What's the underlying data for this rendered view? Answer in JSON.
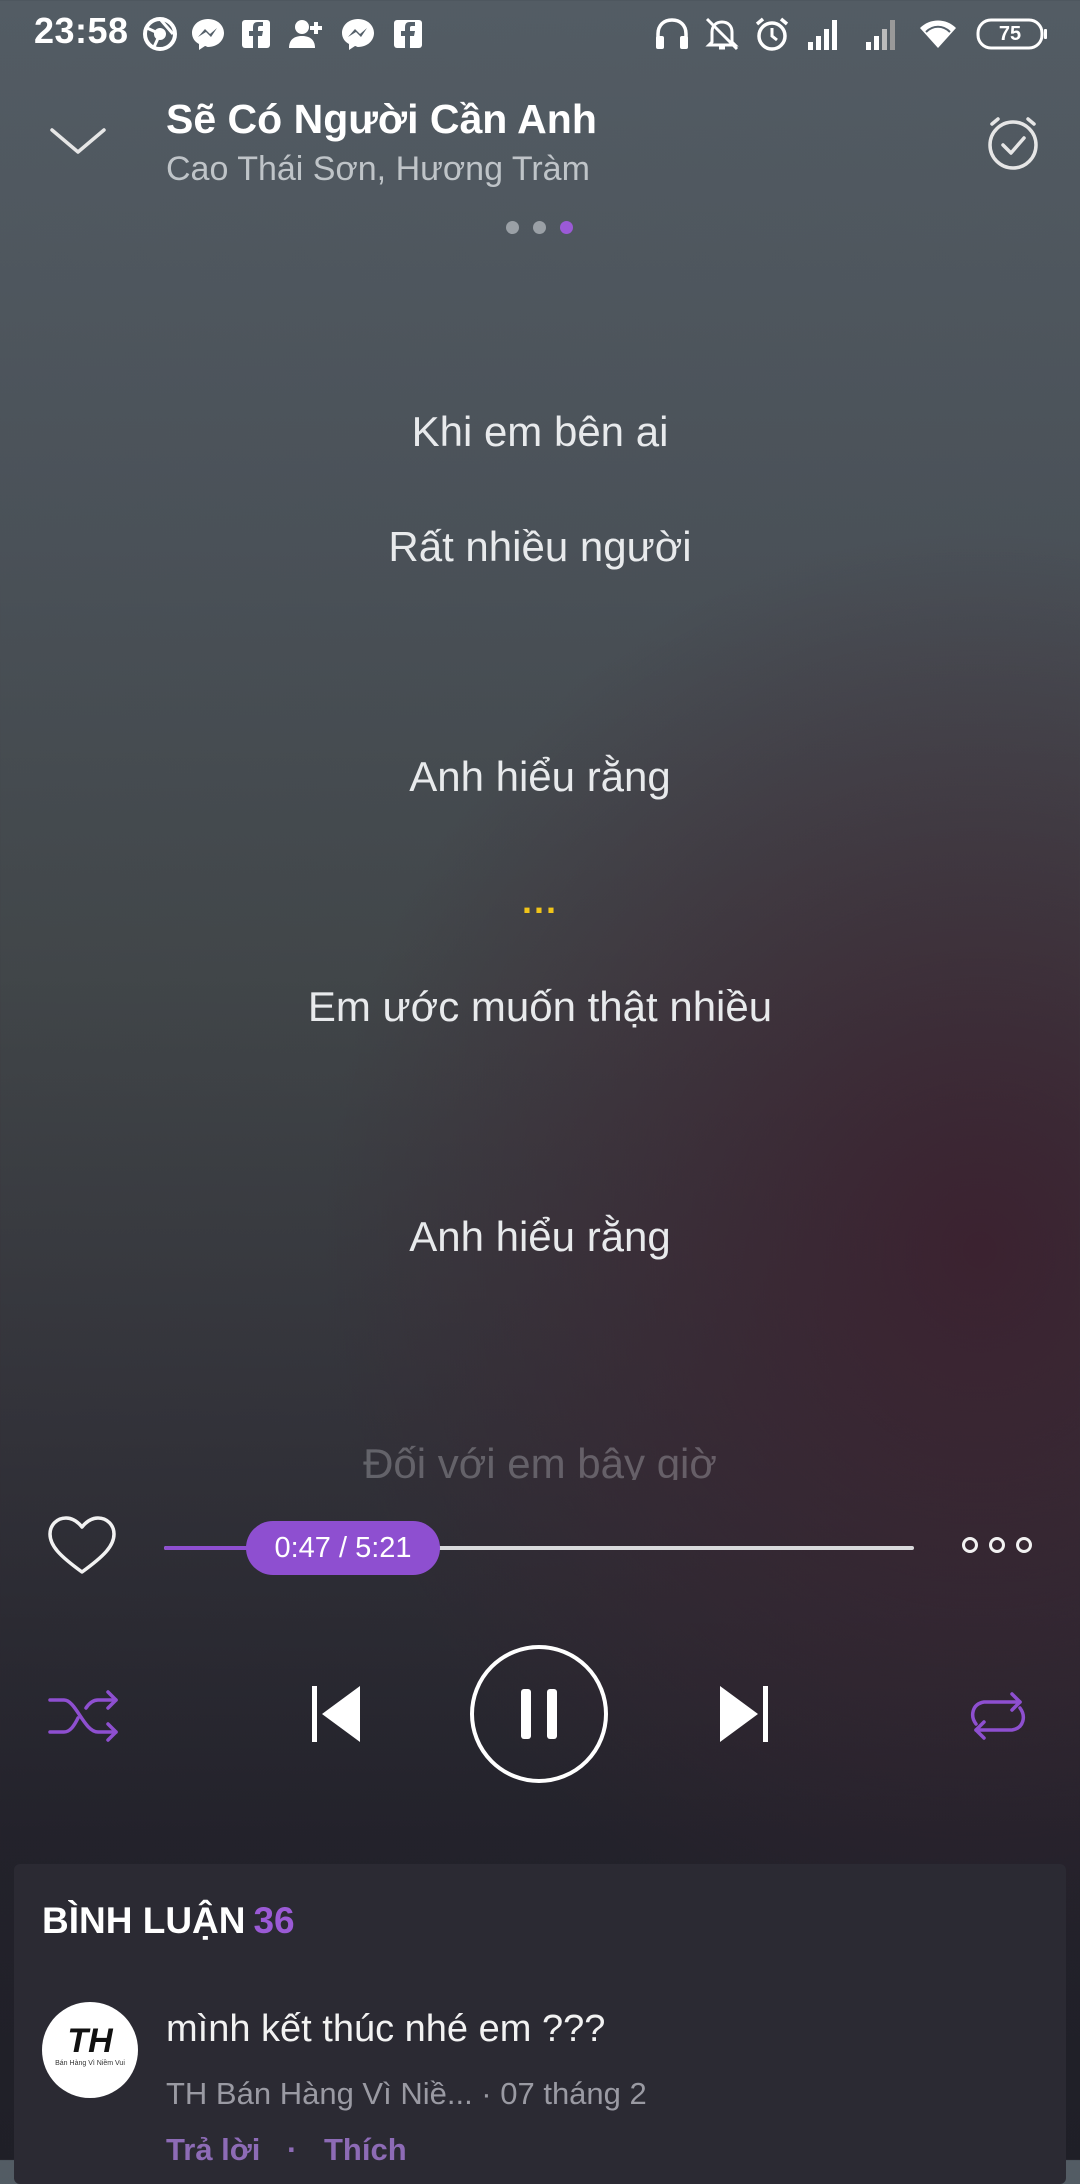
{
  "status_bar": {
    "time": "23:58",
    "battery": "75",
    "icons": [
      "chrome-icon",
      "messenger-icon",
      "facebook-icon",
      "add-friend-icon",
      "messenger-icon",
      "facebook-icon",
      "headphones-icon",
      "mute-icon",
      "alarm-icon",
      "signal-icon",
      "signal-icon",
      "wifi-icon",
      "battery-icon"
    ]
  },
  "header": {
    "song_title": "Sẽ Có Người Cần Anh",
    "artists": "Cao Thái Sơn, Hương Tràm",
    "page_indicator": {
      "count": 3,
      "active_index": 2
    }
  },
  "lyrics": {
    "lines": [
      "Khi em bên ai",
      "Rất nhiều người",
      "Anh hiểu rằng",
      "Em ước muốn thật nhiều",
      "Anh hiểu rằng",
      "Đối với em bây giờ"
    ],
    "ellipsis": "..."
  },
  "player": {
    "position": "0:47",
    "duration": "5:21",
    "time_label": "0:47 / 5:21",
    "progress_fraction": 0.146,
    "accent_color": "#8e4fd0"
  },
  "comments": {
    "title": "BÌNH LUẬN",
    "count": "36",
    "items": [
      {
        "avatar_text": "TH",
        "avatar_subtext": "Bán Hàng Vì Niềm Vui",
        "text": "mình kết thúc nhé em ???",
        "meta": "TH Bán Hàng Vì Niề... · 07 tháng 2",
        "reply": "Trả lời",
        "separator": "·",
        "like": "Thích"
      }
    ]
  }
}
